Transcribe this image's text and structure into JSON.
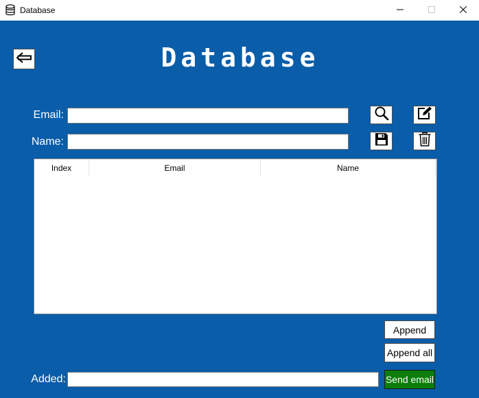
{
  "window": {
    "title": "Database",
    "icon": "database-icon",
    "controls": [
      "minimize-icon",
      "maximize-icon",
      "close-icon"
    ]
  },
  "header": {
    "title": "Database",
    "back_icon": "arrow-left-icon"
  },
  "form": {
    "email_label": "Email:",
    "email_value": "",
    "name_label": "Name:",
    "name_value": "",
    "search_icon": "search-icon",
    "edit_icon": "edit-icon",
    "save_icon": "save-icon",
    "delete_icon": "trash-icon"
  },
  "table": {
    "columns": [
      "Index",
      "Email",
      "Name"
    ],
    "rows": []
  },
  "actions": {
    "append_label": "Append",
    "append_all_label": "Append all",
    "added_label": "Added:",
    "added_value": "",
    "send_email_label": "Send email"
  },
  "colors": {
    "background": "#0a5da9",
    "send_button": "#0a7d0a"
  }
}
